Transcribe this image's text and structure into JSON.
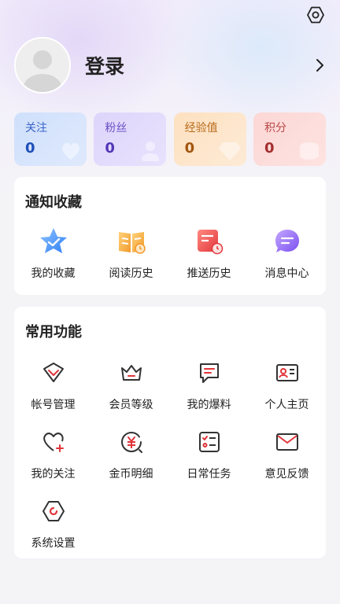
{
  "header": {
    "settings_icon": "settings-hex-icon",
    "login_label": "登录",
    "avatar_icon": "default-avatar",
    "chevron_icon": "chevron-right-icon"
  },
  "stats": [
    {
      "label": "关注",
      "value": "0",
      "color": "#1e4fb8"
    },
    {
      "label": "粉丝",
      "value": "0",
      "color": "#5236b8"
    },
    {
      "label": "经验值",
      "value": "0",
      "color": "#a2560e"
    },
    {
      "label": "积分",
      "value": "0",
      "color": "#a32f2f"
    }
  ],
  "notice_section": {
    "title": "通知收藏",
    "items": [
      {
        "label": "我的收藏",
        "icon": "star-icon"
      },
      {
        "label": "阅读历史",
        "icon": "book-icon"
      },
      {
        "label": "推送历史",
        "icon": "push-history-icon"
      },
      {
        "label": "消息中心",
        "icon": "message-icon"
      }
    ]
  },
  "common_section": {
    "title": "常用功能",
    "items": [
      {
        "label": "帐号管理",
        "icon": "account-icon"
      },
      {
        "label": "会员等级",
        "icon": "crown-icon"
      },
      {
        "label": "我的爆料",
        "icon": "report-icon"
      },
      {
        "label": "个人主页",
        "icon": "id-card-icon"
      },
      {
        "label": "我的关注",
        "icon": "heart-plus-icon"
      },
      {
        "label": "金币明细",
        "icon": "coin-icon"
      },
      {
        "label": "日常任务",
        "icon": "task-list-icon"
      },
      {
        "label": "意见反馈",
        "icon": "mail-icon"
      },
      {
        "label": "系统设置",
        "icon": "settings-icon"
      }
    ]
  },
  "colors": {
    "accent_red": "#e0353a",
    "icon_dark": "#333333"
  }
}
